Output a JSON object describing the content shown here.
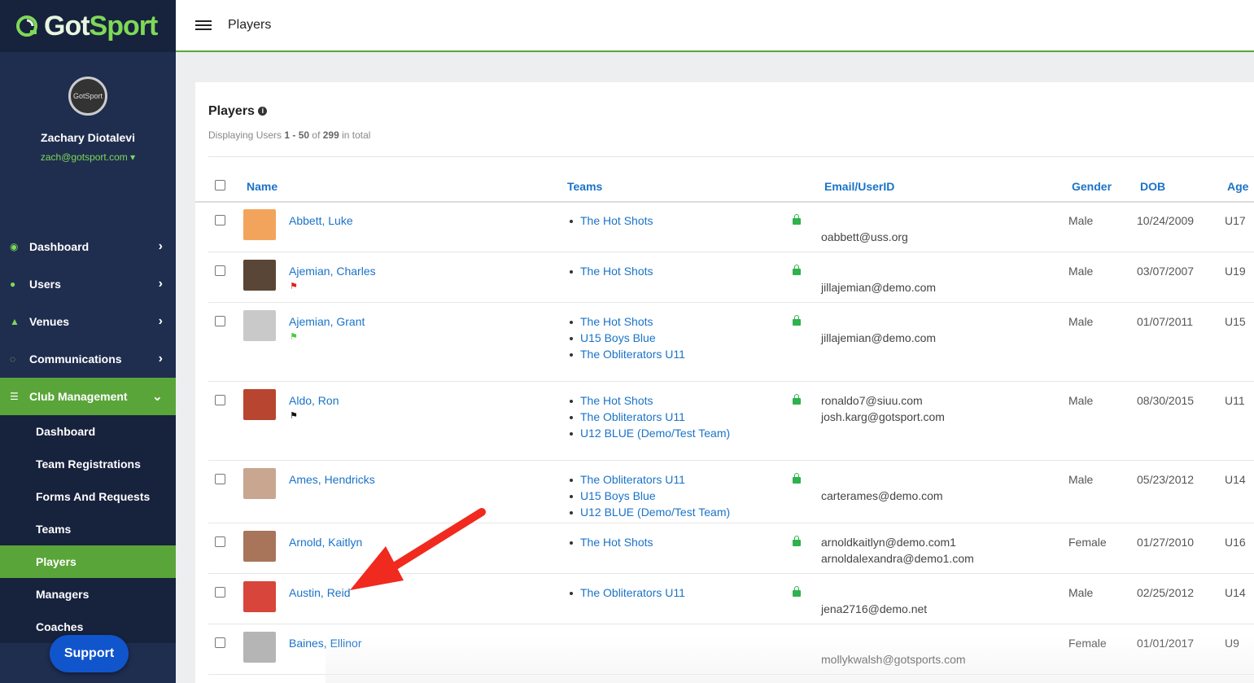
{
  "app": {
    "logo_left": "Got",
    "logo_right": "Sport",
    "page_title": "Players",
    "avatar_text": "GotSport"
  },
  "user": {
    "name": "Zachary Diotalevi",
    "email": "zach@gotsport.com"
  },
  "nav": [
    {
      "label": "Dashboard"
    },
    {
      "label": "Users"
    },
    {
      "label": "Venues"
    },
    {
      "label": "Communications"
    },
    {
      "label": "Club Management"
    }
  ],
  "subnav": [
    {
      "label": "Dashboard"
    },
    {
      "label": "Team Registrations"
    },
    {
      "label": "Forms And Requests"
    },
    {
      "label": "Teams"
    },
    {
      "label": "Players"
    },
    {
      "label": "Managers"
    },
    {
      "label": "Coaches"
    }
  ],
  "support_label": "Support",
  "card": {
    "title": "Players",
    "sub_prefix": "Displaying Users ",
    "sub_range": "1 - 50",
    "sub_of": " of ",
    "sub_total": "299",
    "sub_suffix": " in total"
  },
  "columns": {
    "name": "Name",
    "teams": "Teams",
    "email": "Email/UserID",
    "gender": "Gender",
    "dob": "DOB",
    "age": "Age"
  },
  "rows": [
    {
      "name": "Abbett, Luke",
      "teams": [
        "The Hot Shots"
      ],
      "emails": [
        "",
        "oabbett@uss.org"
      ],
      "gender": "Male",
      "dob": "10/24/2009",
      "age": "U17",
      "flag": "",
      "photo": "#f3a45c"
    },
    {
      "name": "Ajemian, Charles",
      "teams": [
        "The Hot Shots"
      ],
      "emails": [
        "",
        "jillajemian@demo.com"
      ],
      "gender": "Male",
      "dob": "03/07/2007",
      "age": "U19",
      "flag": "#e02020",
      "photo": "#5a4636"
    },
    {
      "name": "Ajemian, Grant",
      "teams": [
        "The Hot Shots",
        "U15 Boys Blue",
        "The Obliterators U11"
      ],
      "emails": [
        "",
        "jillajemian@demo.com"
      ],
      "gender": "Male",
      "dob": "01/07/2011",
      "age": "U15",
      "flag": "#4cc93a",
      "photo": "#c9c9c9"
    },
    {
      "name": "Aldo, Ron",
      "teams": [
        "The Hot Shots",
        "The Obliterators U11",
        "U12 BLUE (Demo/Test Team)"
      ],
      "emails": [
        "ronaldo7@siuu.com",
        "josh.karg@gotsport.com"
      ],
      "gender": "Male",
      "dob": "08/30/2015",
      "age": "U11",
      "flag": "#111111",
      "photo": "#b8452f"
    },
    {
      "name": "Ames, Hendricks",
      "teams": [
        "The Obliterators U11",
        "U15 Boys Blue",
        "U12 BLUE (Demo/Test Team)"
      ],
      "emails": [
        "",
        "carterames@demo.com"
      ],
      "gender": "Male",
      "dob": "05/23/2012",
      "age": "U14",
      "flag": "",
      "photo": "#c8a690"
    },
    {
      "name": "Arnold, Kaitlyn",
      "teams": [
        "The Hot Shots"
      ],
      "emails": [
        "arnoldkaitlyn@demo.com1",
        "arnoldalexandra@demo1.com"
      ],
      "gender": "Female",
      "dob": "01/27/2010",
      "age": "U16",
      "flag": "",
      "photo": "#a8745a"
    },
    {
      "name": "Austin, Reid",
      "teams": [
        "The Obliterators U11"
      ],
      "emails": [
        "",
        "jena2716@demo.net"
      ],
      "gender": "Male",
      "dob": "02/25/2012",
      "age": "U14",
      "flag": "",
      "photo": "#d8453a"
    },
    {
      "name": "Baines, Ellinor",
      "teams": [],
      "emails": [
        "",
        "mollykwalsh@gotsports.com"
      ],
      "gender": "Female",
      "dob": "01/01/2017",
      "age": "U9",
      "flag": "",
      "photo": "#b5b5b5"
    }
  ]
}
